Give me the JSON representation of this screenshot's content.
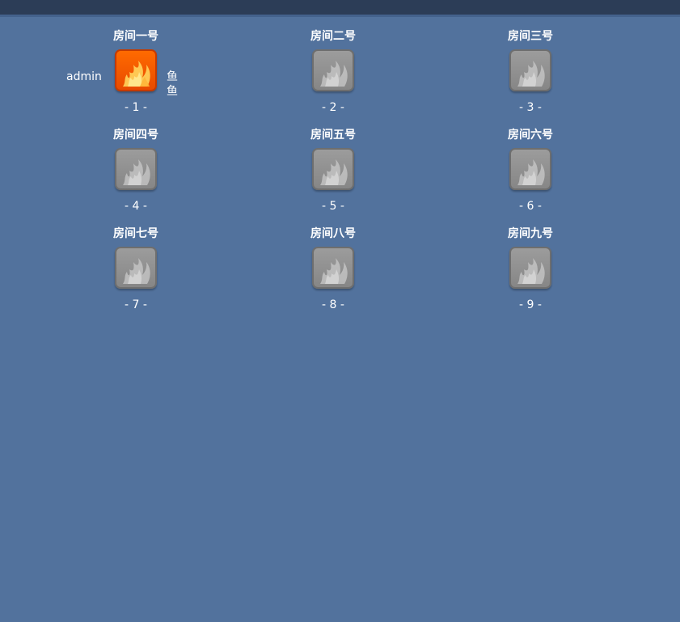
{
  "rooms": [
    {
      "title": "房间一号",
      "number": "- 1 -",
      "state": "active",
      "left_player": "admin",
      "right_player": "鱼鱼"
    },
    {
      "title": "房间二号",
      "number": "- 2 -",
      "state": "idle"
    },
    {
      "title": "房间三号",
      "number": "- 3 -",
      "state": "idle"
    },
    {
      "title": "房间四号",
      "number": "- 4 -",
      "state": "idle"
    },
    {
      "title": "房间五号",
      "number": "- 5 -",
      "state": "idle"
    },
    {
      "title": "房间六号",
      "number": "- 6 -",
      "state": "idle"
    },
    {
      "title": "房间七号",
      "number": "- 7 -",
      "state": "idle"
    },
    {
      "title": "房间八号",
      "number": "- 8 -",
      "state": "idle"
    },
    {
      "title": "房间九号",
      "number": "- 9 -",
      "state": "idle"
    }
  ],
  "icons": {
    "table": "flame-icon"
  },
  "colors": {
    "background": "#52729d",
    "topbar": "#2c3d57",
    "active_table": "#ff6a00",
    "idle_table": "#8e8e8e"
  }
}
